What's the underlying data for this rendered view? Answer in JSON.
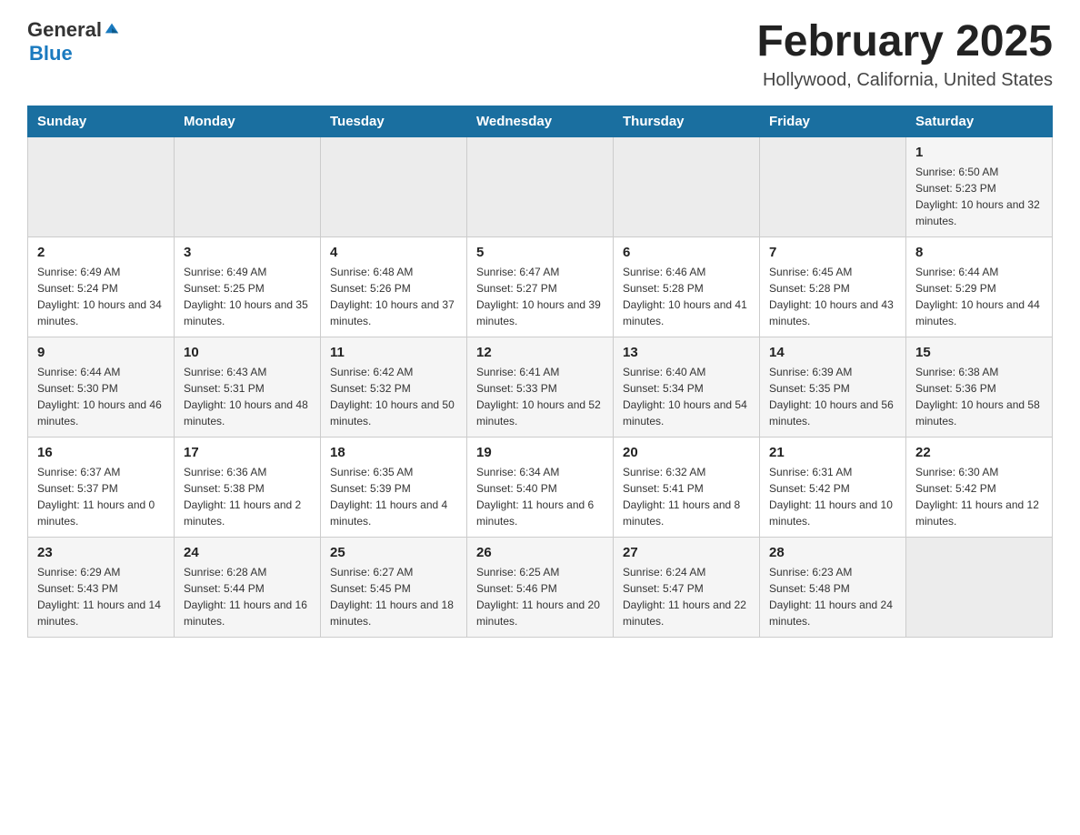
{
  "header": {
    "logo_general": "General",
    "logo_blue": "Blue",
    "title": "February 2025",
    "subtitle": "Hollywood, California, United States"
  },
  "days_of_week": [
    "Sunday",
    "Monday",
    "Tuesday",
    "Wednesday",
    "Thursday",
    "Friday",
    "Saturday"
  ],
  "weeks": [
    {
      "days": [
        {
          "number": "",
          "info": ""
        },
        {
          "number": "",
          "info": ""
        },
        {
          "number": "",
          "info": ""
        },
        {
          "number": "",
          "info": ""
        },
        {
          "number": "",
          "info": ""
        },
        {
          "number": "",
          "info": ""
        },
        {
          "number": "1",
          "info": "Sunrise: 6:50 AM\nSunset: 5:23 PM\nDaylight: 10 hours and 32 minutes."
        }
      ]
    },
    {
      "days": [
        {
          "number": "2",
          "info": "Sunrise: 6:49 AM\nSunset: 5:24 PM\nDaylight: 10 hours and 34 minutes."
        },
        {
          "number": "3",
          "info": "Sunrise: 6:49 AM\nSunset: 5:25 PM\nDaylight: 10 hours and 35 minutes."
        },
        {
          "number": "4",
          "info": "Sunrise: 6:48 AM\nSunset: 5:26 PM\nDaylight: 10 hours and 37 minutes."
        },
        {
          "number": "5",
          "info": "Sunrise: 6:47 AM\nSunset: 5:27 PM\nDaylight: 10 hours and 39 minutes."
        },
        {
          "number": "6",
          "info": "Sunrise: 6:46 AM\nSunset: 5:28 PM\nDaylight: 10 hours and 41 minutes."
        },
        {
          "number": "7",
          "info": "Sunrise: 6:45 AM\nSunset: 5:28 PM\nDaylight: 10 hours and 43 minutes."
        },
        {
          "number": "8",
          "info": "Sunrise: 6:44 AM\nSunset: 5:29 PM\nDaylight: 10 hours and 44 minutes."
        }
      ]
    },
    {
      "days": [
        {
          "number": "9",
          "info": "Sunrise: 6:44 AM\nSunset: 5:30 PM\nDaylight: 10 hours and 46 minutes."
        },
        {
          "number": "10",
          "info": "Sunrise: 6:43 AM\nSunset: 5:31 PM\nDaylight: 10 hours and 48 minutes."
        },
        {
          "number": "11",
          "info": "Sunrise: 6:42 AM\nSunset: 5:32 PM\nDaylight: 10 hours and 50 minutes."
        },
        {
          "number": "12",
          "info": "Sunrise: 6:41 AM\nSunset: 5:33 PM\nDaylight: 10 hours and 52 minutes."
        },
        {
          "number": "13",
          "info": "Sunrise: 6:40 AM\nSunset: 5:34 PM\nDaylight: 10 hours and 54 minutes."
        },
        {
          "number": "14",
          "info": "Sunrise: 6:39 AM\nSunset: 5:35 PM\nDaylight: 10 hours and 56 minutes."
        },
        {
          "number": "15",
          "info": "Sunrise: 6:38 AM\nSunset: 5:36 PM\nDaylight: 10 hours and 58 minutes."
        }
      ]
    },
    {
      "days": [
        {
          "number": "16",
          "info": "Sunrise: 6:37 AM\nSunset: 5:37 PM\nDaylight: 11 hours and 0 minutes."
        },
        {
          "number": "17",
          "info": "Sunrise: 6:36 AM\nSunset: 5:38 PM\nDaylight: 11 hours and 2 minutes."
        },
        {
          "number": "18",
          "info": "Sunrise: 6:35 AM\nSunset: 5:39 PM\nDaylight: 11 hours and 4 minutes."
        },
        {
          "number": "19",
          "info": "Sunrise: 6:34 AM\nSunset: 5:40 PM\nDaylight: 11 hours and 6 minutes."
        },
        {
          "number": "20",
          "info": "Sunrise: 6:32 AM\nSunset: 5:41 PM\nDaylight: 11 hours and 8 minutes."
        },
        {
          "number": "21",
          "info": "Sunrise: 6:31 AM\nSunset: 5:42 PM\nDaylight: 11 hours and 10 minutes."
        },
        {
          "number": "22",
          "info": "Sunrise: 6:30 AM\nSunset: 5:42 PM\nDaylight: 11 hours and 12 minutes."
        }
      ]
    },
    {
      "days": [
        {
          "number": "23",
          "info": "Sunrise: 6:29 AM\nSunset: 5:43 PM\nDaylight: 11 hours and 14 minutes."
        },
        {
          "number": "24",
          "info": "Sunrise: 6:28 AM\nSunset: 5:44 PM\nDaylight: 11 hours and 16 minutes."
        },
        {
          "number": "25",
          "info": "Sunrise: 6:27 AM\nSunset: 5:45 PM\nDaylight: 11 hours and 18 minutes."
        },
        {
          "number": "26",
          "info": "Sunrise: 6:25 AM\nSunset: 5:46 PM\nDaylight: 11 hours and 20 minutes."
        },
        {
          "number": "27",
          "info": "Sunrise: 6:24 AM\nSunset: 5:47 PM\nDaylight: 11 hours and 22 minutes."
        },
        {
          "number": "28",
          "info": "Sunrise: 6:23 AM\nSunset: 5:48 PM\nDaylight: 11 hours and 24 minutes."
        },
        {
          "number": "",
          "info": ""
        }
      ]
    }
  ]
}
